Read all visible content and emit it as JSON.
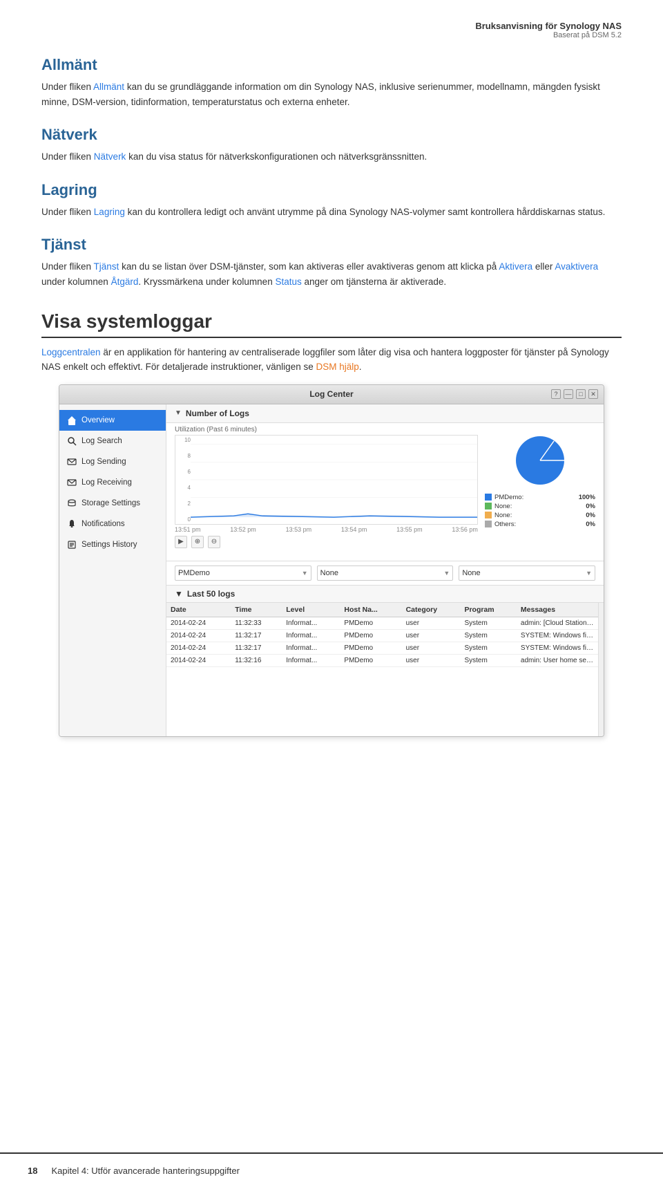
{
  "header": {
    "title_main": "Bruksanvisning för Synology NAS",
    "title_sub": "Baserat på DSM 5.2"
  },
  "sections": {
    "allman": {
      "title": "Allmänt",
      "body": "Under fliken Allmänt kan du se grundläggande information om din Synology NAS, inklusive serienummer, modellnamn, mängden fysiskt minne, DSM-version, tidinformation, temperaturstatus och externa enheter.",
      "link_text": "Allmänt"
    },
    "natverk": {
      "title": "Nätverk",
      "body_prefix": "Under fliken ",
      "link_text": "Nätverk",
      "body_suffix": " kan du visa status för nätverkskonfigurationen och nätverksgränssnitten."
    },
    "lagring": {
      "title": "Lagring",
      "body_prefix": "Under fliken ",
      "link_text": "Lagring",
      "body_suffix": " kan du kontrollera ledigt och använt utrymme på dina Synology NAS-volymer samt kontrollera hårddiskarnas status."
    },
    "tjanst": {
      "title": "Tjänst",
      "body_prefix": "Under fliken ",
      "link_text": "Tjänst",
      "body_middle": " kan du se listan över DSM-tjänster, som kan aktiveras eller avaktiveras genom att klicka på ",
      "link_aktivera": "Aktivera",
      "body_or": " eller ",
      "link_avaktivera": "Avaktivera",
      "body_suffix1": " under kolumnen ",
      "link_atgard": "Åtgärd",
      "body_suffix2": ". Kryssmärkena under kolumnen ",
      "link_status": "Status",
      "body_suffix3": " anger om tjänsterna är aktiverade."
    }
  },
  "visa_section": {
    "title": "Visa systemloggar",
    "body_prefix": "",
    "link_loggcentralen": "Loggcentralen",
    "body_text": " är en applikation för hantering av centraliserade loggfiler som låter dig visa och hantera loggposter för tjänster på Synology NAS enkelt och effektivt. För detaljerade instruktioner, vänligen se ",
    "link_dsm_hjalp": "DSM hjälp",
    "body_suffix": "."
  },
  "app_window": {
    "title": "Log Center",
    "controls": [
      "?",
      "—",
      "□",
      "✕"
    ],
    "sidebar": {
      "items": [
        {
          "id": "overview",
          "label": "Overview",
          "active": true,
          "icon": "home"
        },
        {
          "id": "log-search",
          "label": "Log Search",
          "active": false,
          "icon": "search"
        },
        {
          "id": "log-sending",
          "label": "Log Sending",
          "active": false,
          "icon": "send"
        },
        {
          "id": "log-receiving",
          "label": "Log Receiving",
          "active": false,
          "icon": "receive"
        },
        {
          "id": "storage-settings",
          "label": "Storage Settings",
          "active": false,
          "icon": "storage"
        },
        {
          "id": "notifications",
          "label": "Notifications",
          "active": false,
          "icon": "bell"
        },
        {
          "id": "settings-history",
          "label": "Settings History",
          "active": false,
          "icon": "history"
        }
      ]
    },
    "chart_section": {
      "header": "Number of Logs",
      "subtitle": "Utilization (Past 6 minutes)",
      "y_labels": [
        "10",
        "8",
        "6",
        "4",
        "2",
        "0"
      ],
      "time_labels": [
        "13:51 pm",
        "13:52 pm",
        "13:53 pm",
        "13:54 pm",
        "13:55 pm",
        "13:56 pm"
      ],
      "controls": [
        "▶",
        "⊕",
        "⊖"
      ],
      "legend": [
        {
          "label": "PMDemo:",
          "pct": "100%",
          "color": "#2a7ae2"
        },
        {
          "label": "None:",
          "pct": "0%",
          "color": "#5cb85c"
        },
        {
          "label": "None:",
          "pct": "0%",
          "color": "#f0ad4e"
        },
        {
          "label": "Others:",
          "pct": "0%",
          "color": "#aaa"
        }
      ]
    },
    "dropdowns": [
      {
        "value": "PMDemo",
        "id": "dd-pmdemo"
      },
      {
        "value": "None",
        "id": "dd-none1"
      },
      {
        "value": "None",
        "id": "dd-none2"
      }
    ],
    "logs_section": {
      "header": "Last 50 logs",
      "columns": [
        "Date",
        "Time",
        "Level",
        "Host Na...",
        "Category",
        "Program",
        "Messages"
      ],
      "rows": [
        {
          "date": "2014-02-24",
          "time": "11:32:33",
          "level": "Informat...",
          "host": "PMDemo",
          "category": "user",
          "program": "System",
          "message": "admin: [Cloud Station] service was star..."
        },
        {
          "date": "2014-02-24",
          "time": "11:32:17",
          "level": "Informat...",
          "host": "PMDemo",
          "category": "user",
          "program": "System",
          "message": "SYSTEM: Windows file service was start..."
        },
        {
          "date": "2014-02-24",
          "time": "11:32:17",
          "level": "Informat...",
          "host": "PMDemo",
          "category": "user",
          "program": "System",
          "message": "SYSTEM: Windows file service was stop..."
        },
        {
          "date": "2014-02-24",
          "time": "11:32:16",
          "level": "Informat...",
          "host": "PMDemo",
          "category": "user",
          "program": "System",
          "message": "admin: User home service enable, set ..."
        }
      ]
    }
  },
  "footer": {
    "page_number": "18",
    "chapter_text": "Kapitel 4: Utför avancerade hanteringsuppgifter"
  }
}
